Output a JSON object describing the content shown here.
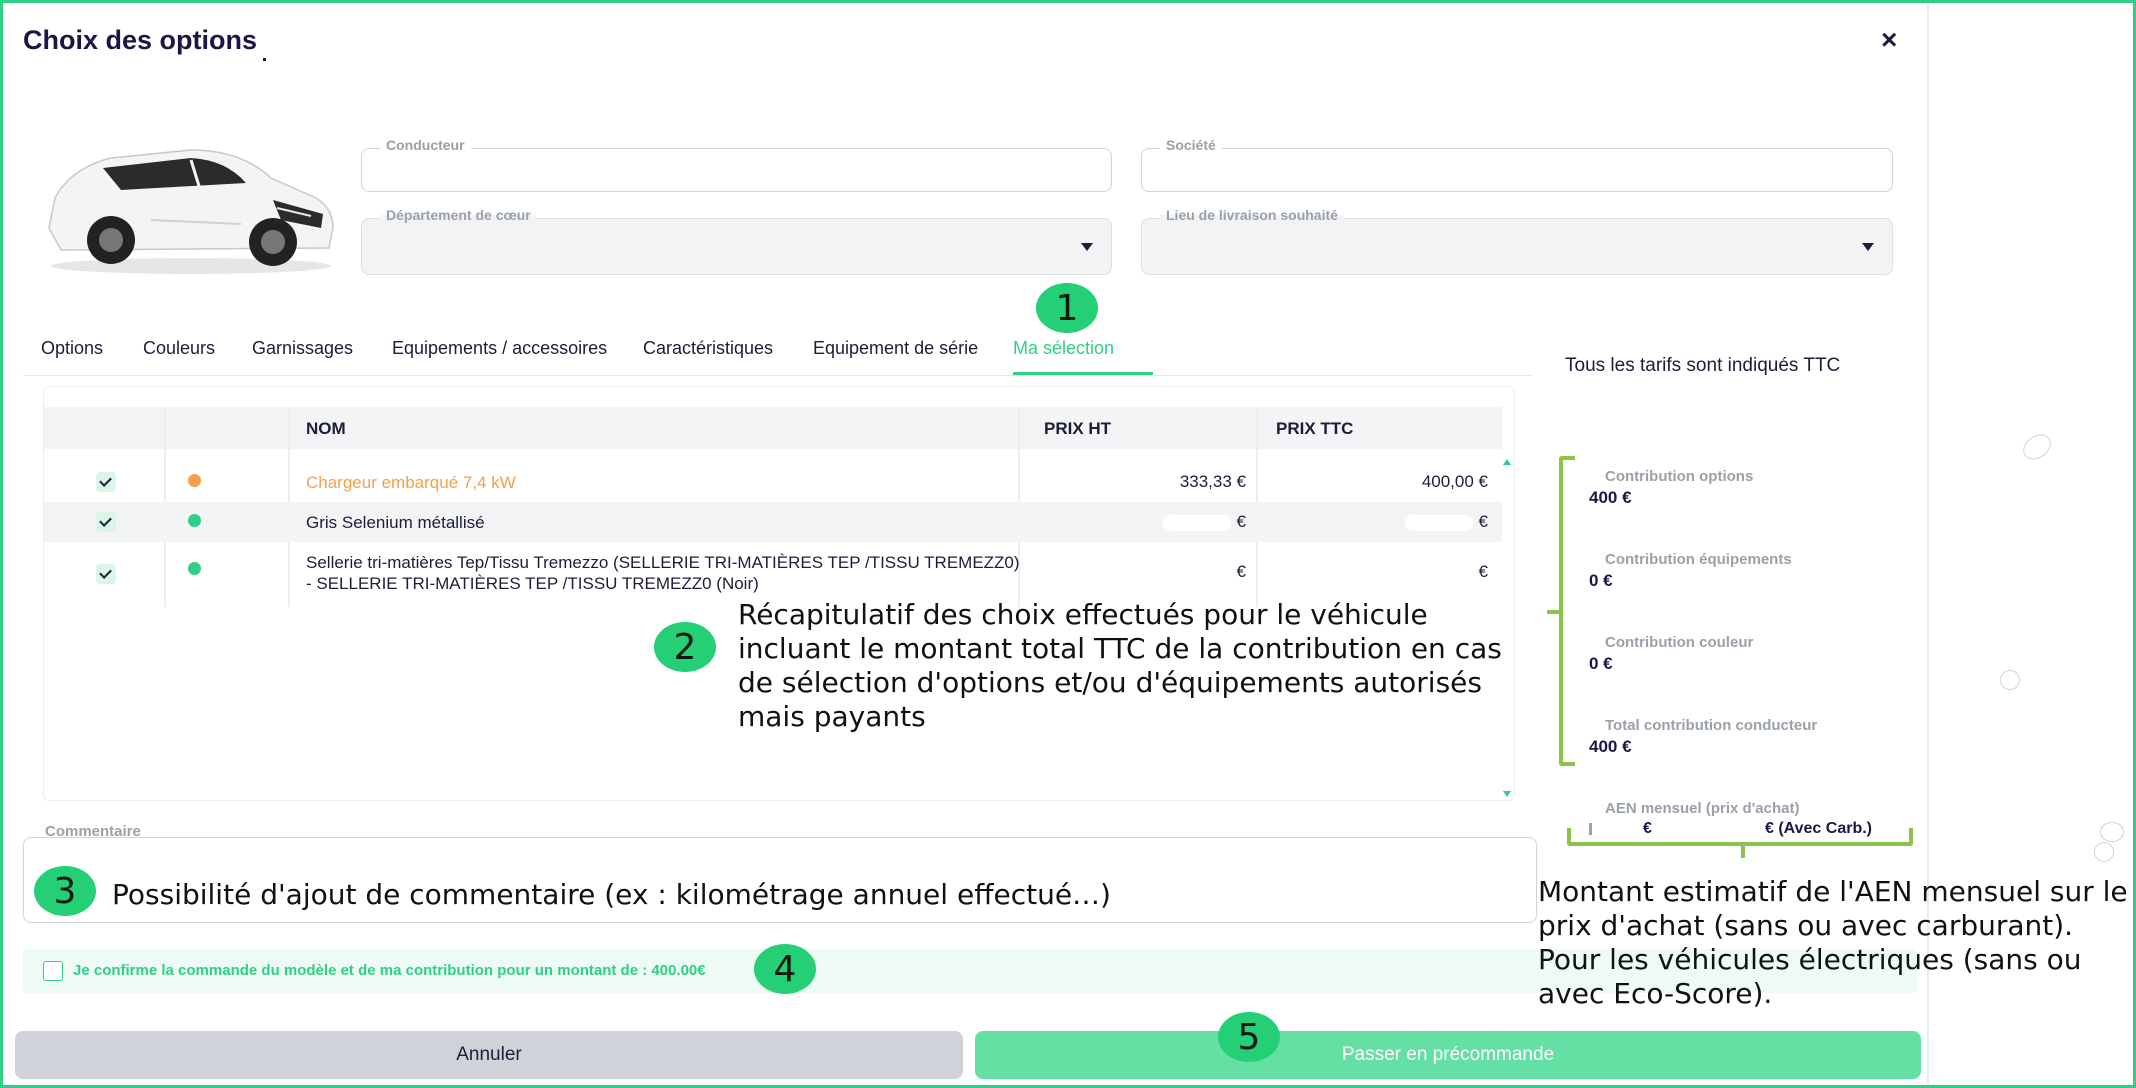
{
  "dialog": {
    "title": "Choix des options",
    "close_label": "×"
  },
  "fields": {
    "conducteur": {
      "label": "Conducteur",
      "value": ""
    },
    "societe": {
      "label": "Société",
      "value": ""
    },
    "departement": {
      "label": "Département de cœur",
      "value": ""
    },
    "lieu": {
      "label": "Lieu de livraison souhaité",
      "value": ""
    }
  },
  "tabs": [
    {
      "label": "Options"
    },
    {
      "label": "Couleurs"
    },
    {
      "label": "Garnissages"
    },
    {
      "label": "Equipements / accessoires"
    },
    {
      "label": "Caractéristiques"
    },
    {
      "label": "Equipement de série"
    },
    {
      "label": "Ma sélection",
      "active": true
    }
  ],
  "tarif_note": "Tous les tarifs sont indiqués TTC",
  "table": {
    "headers": {
      "name": "NOM",
      "prix_ht": "PRIX HT",
      "prix_ttc": "PRIX TTC"
    },
    "rows": [
      {
        "name": "Chargeur embarqué 7,4 kW",
        "prix_ht": "333,33 €",
        "prix_ttc": "400,00 €",
        "dot_color": "#f5a04a",
        "name_color": "#f5a04a"
      },
      {
        "name": "Gris Selenium métallisé",
        "prix_ht": "€",
        "prix_ttc": "€",
        "dot_color": "#2fcf86",
        "name_color": "#1d1d3a"
      },
      {
        "name": "Sellerie tri-matières Tep/Tissu Tremezzo (SELLERIE TRI-MATIÈRES TEP /TISSU TREMEZZ0) - SELLERIE TRI-MATIÈRES TEP /TISSU TREMEZZ0 (Noir)",
        "prix_ht": "€",
        "prix_ttc": "€",
        "dot_color": "#2fcf86",
        "name_color": "#1d1d3a"
      }
    ]
  },
  "contributions": [
    {
      "label": "Contribution options",
      "value": "400 €"
    },
    {
      "label": "Contribution équipements",
      "value": "0 €"
    },
    {
      "label": "Contribution couleur",
      "value": "0 €"
    },
    {
      "label": "Total contribution conducteur",
      "value": "400 €"
    }
  ],
  "aen": {
    "label": "AEN mensuel (prix d'achat)",
    "value_left": "€",
    "value_right": "€ (Avec Carb.)"
  },
  "comment": {
    "label": "Commentaire",
    "value": ""
  },
  "confirm": {
    "text": "Je confirme la commande du modèle et de ma contribution pour un montant de : 400.00€"
  },
  "buttons": {
    "cancel": "Annuler",
    "order": "Passer en précommande"
  },
  "annotations": {
    "b1": "1",
    "b2": "2",
    "b3": "3",
    "b4": "4",
    "b5": "5",
    "note2": "Récapitulatif des choix effectués pour le véhicule incluant le montant total TTC de la contribution en cas de sélection d'options et/ou d'équipements autorisés mais payants",
    "note3": "Possibilité d'ajout de commentaire (ex : kilométrage annuel effectué…)",
    "note_aen": "Montant estimatif de l'AEN mensuel sur le prix d'achat (sans ou avec carburant). Pour les véhicules électriques (sans ou avec Eco-Score)."
  },
  "colors": {
    "accent": "#2fcf86",
    "orange": "#f5a04a",
    "badge": "#24cf76",
    "bracket": "#8dc34a"
  }
}
